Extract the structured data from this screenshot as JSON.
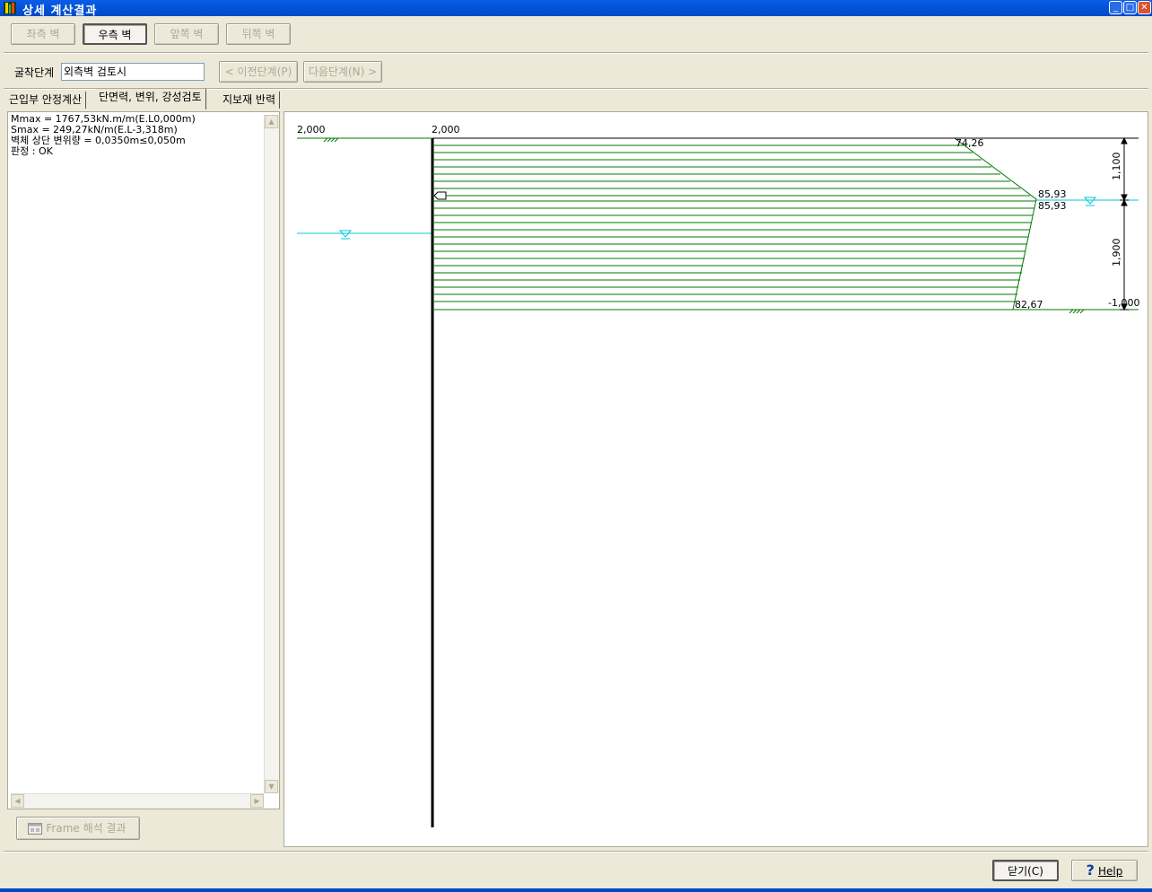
{
  "window": {
    "title": "상세 계산결과",
    "controls": [
      "minimize",
      "maximize",
      "close"
    ]
  },
  "wall_buttons": [
    {
      "label": "좌측 벽",
      "state": "disabled"
    },
    {
      "label": "우측 벽",
      "state": "pressed"
    },
    {
      "label": "앞쪽 벽",
      "state": "disabled"
    },
    {
      "label": "뒤쪽 벽",
      "state": "disabled"
    }
  ],
  "stage": {
    "label": "굴착단계",
    "value": "외측벽 검토시",
    "prev_label": "< 이전단계(P)",
    "next_label": "다음단계(N) >"
  },
  "tabs": [
    {
      "label": "근입부 안정계산",
      "active": false
    },
    {
      "label": "단면력, 변위, 강성검토",
      "active": true
    },
    {
      "label": "지보재 반력",
      "active": false
    }
  ],
  "results": [
    "Mmax = 1767,53kN.m/m(E.L0,000m)",
    "Smax = 249,27kN/m(E.L-3,318m)",
    "벽체 상단 변위량 = 0,0350m≤0,050m",
    "판정 : OK"
  ],
  "frame_button": {
    "label": "Frame 해석 결과",
    "icon": "frame-result-icon",
    "state": "disabled"
  },
  "diagram": {
    "left_ground_level": "2,000",
    "wall_top_level": "2,000",
    "pressure_labels": [
      "74,26",
      "85,93",
      "85,93",
      "82,67"
    ],
    "dimensions": [
      "1,100",
      "1,900"
    ],
    "bottom_level": "-1,000",
    "pressure_color": "#007800",
    "water_color": "#00c8d8"
  },
  "footer": {
    "close_label": "닫기(C)",
    "help_label": "Help",
    "help_icon": "question-icon"
  }
}
